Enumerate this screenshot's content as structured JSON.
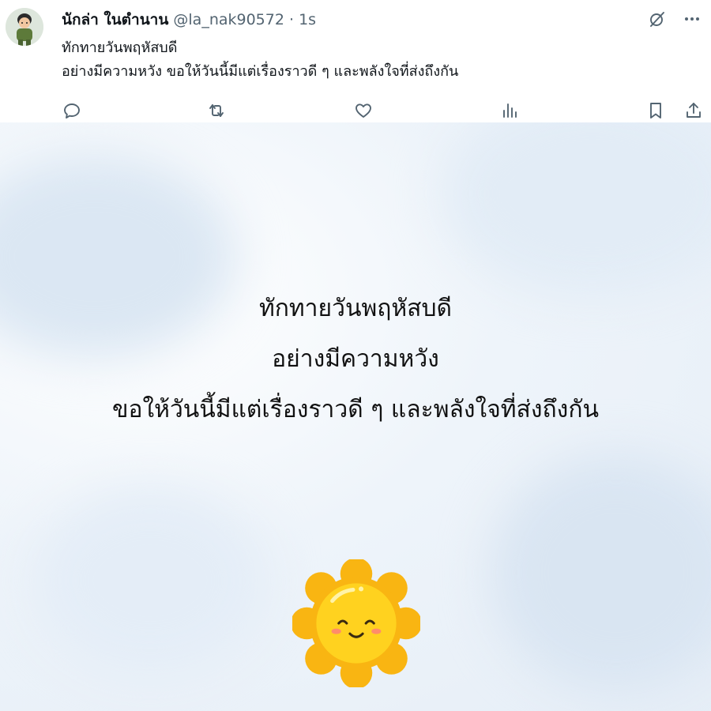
{
  "tweet": {
    "display_name": "นักล่า ในตำนาน",
    "handle": "@la_nak90572",
    "separator": "·",
    "time": "1s",
    "text_lines": [
      "ทักทายวันพฤหัสบดี",
      "อย่างมีความหวัง ขอให้วันนี้มีแต่เรื่องราวดี ๆ และพลังใจที่ส่งถึงกัน"
    ]
  },
  "icons": {
    "top_right": [
      "grok-icon",
      "more-icon"
    ],
    "actions": [
      "reply-icon",
      "retweet-icon",
      "like-icon",
      "views-icon",
      "bookmark-icon",
      "share-icon"
    ]
  },
  "media": {
    "lines": [
      "ทักทายวันพฤหัสบดี",
      "อย่างมีความหวัง",
      "ขอให้วันนี้มีแต่เรื่องราวดี ๆ และพลังใจที่ส่งถึงกัน"
    ]
  },
  "colors": {
    "secondary_text": "#536471",
    "sun_yellow": "#ffd21f",
    "sun_orange": "#f9b512"
  }
}
